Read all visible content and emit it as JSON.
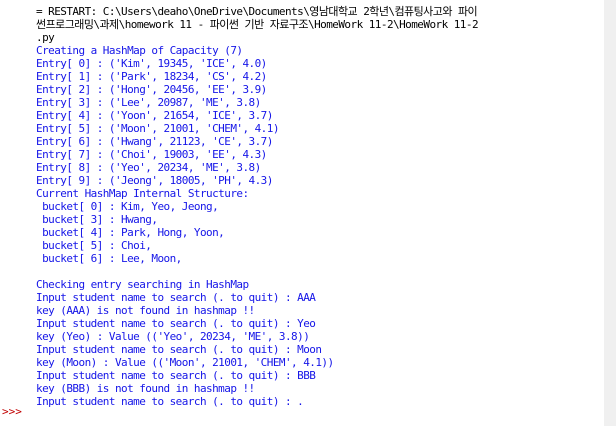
{
  "prompt": ">>>",
  "lines": [
    {
      "text": "= RESTART: C:\\Users\\deaho\\OneDrive\\Documents\\영남대학교 2학년\\컴퓨팅사고와 파이",
      "color": "black"
    },
    {
      "text": "썬프로그래밍\\과제\\homework 11 - 파이썬 기반 자료구조\\HomeWork 11-2\\HomeWork 11-2",
      "color": "black"
    },
    {
      "text": ".py",
      "color": "black"
    },
    {
      "text": "Creating a HashMap of Capacity (7)",
      "color": "blue"
    },
    {
      "text": "Entry[ 0] : ('Kim', 19345, 'ICE', 4.0)",
      "color": "blue"
    },
    {
      "text": "Entry[ 1] : ('Park', 18234, 'CS', 4.2)",
      "color": "blue"
    },
    {
      "text": "Entry[ 2] : ('Hong', 20456, 'EE', 3.9)",
      "color": "blue"
    },
    {
      "text": "Entry[ 3] : ('Lee', 20987, 'ME', 3.8)",
      "color": "blue"
    },
    {
      "text": "Entry[ 4] : ('Yoon', 21654, 'ICE', 3.7)",
      "color": "blue"
    },
    {
      "text": "Entry[ 5] : ('Moon', 21001, 'CHEM', 4.1)",
      "color": "blue"
    },
    {
      "text": "Entry[ 6] : ('Hwang', 21123, 'CE', 3.7)",
      "color": "blue"
    },
    {
      "text": "Entry[ 7] : ('Choi', 19003, 'EE', 4.3)",
      "color": "blue"
    },
    {
      "text": "Entry[ 8] : ('Yeo', 20234, 'ME', 3.8)",
      "color": "blue"
    },
    {
      "text": "Entry[ 9] : ('Jeong', 18005, 'PH', 4.3)",
      "color": "blue"
    },
    {
      "text": "Current HashMap Internal Structure:",
      "color": "blue"
    },
    {
      "text": " bucket[ 0] : Kim, Yeo, Jeong,",
      "color": "blue"
    },
    {
      "text": " bucket[ 3] : Hwang,",
      "color": "blue"
    },
    {
      "text": " bucket[ 4] : Park, Hong, Yoon,",
      "color": "blue"
    },
    {
      "text": " bucket[ 5] : Choi,",
      "color": "blue"
    },
    {
      "text": " bucket[ 6] : Lee, Moon,",
      "color": "blue"
    },
    {
      "text": "",
      "color": "blue"
    },
    {
      "text": "Checking entry searching in HashMap",
      "color": "blue"
    },
    {
      "text": "Input student name to search (. to quit) : AAA",
      "color": "blue"
    },
    {
      "text": "key (AAA) is not found in hashmap !!",
      "color": "blue"
    },
    {
      "text": "Input student name to search (. to quit) : Yeo",
      "color": "blue"
    },
    {
      "text": "key (Yeo) : Value (('Yeo', 20234, 'ME', 3.8))",
      "color": "blue"
    },
    {
      "text": "Input student name to search (. to quit) : Moon",
      "color": "blue"
    },
    {
      "text": "key (Moon) : Value (('Moon', 21001, 'CHEM', 4.1))",
      "color": "blue"
    },
    {
      "text": "Input student name to search (. to quit) : BBB",
      "color": "blue"
    },
    {
      "text": "key (BBB) is not found in hashmap !!",
      "color": "blue"
    },
    {
      "text": "Input student name to search (. to quit) : .",
      "color": "blue"
    }
  ]
}
